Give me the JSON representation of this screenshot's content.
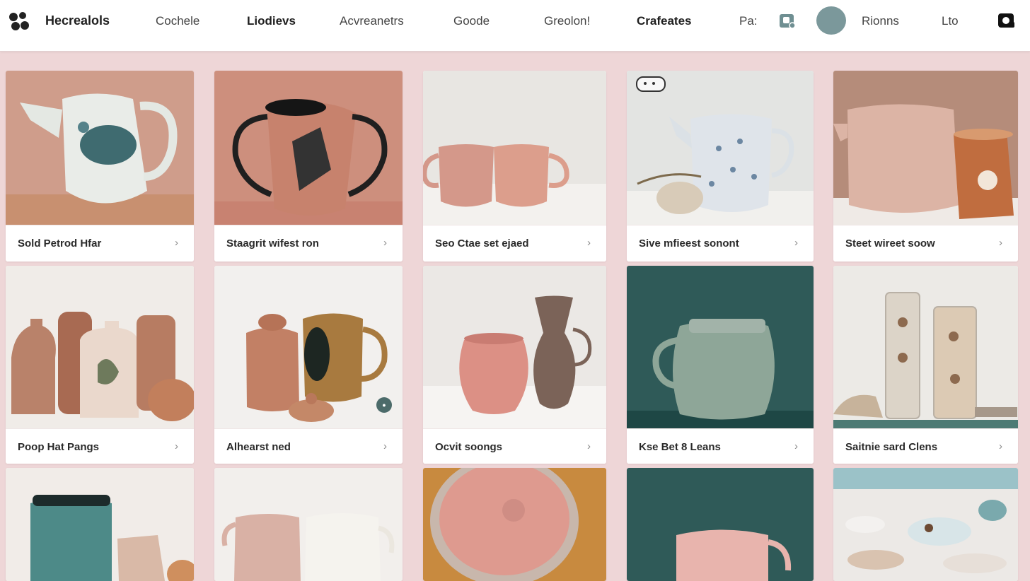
{
  "header": {
    "brand": "Hecrealols",
    "nav": [
      "Cochele",
      "Liodievs",
      "Acvreanetrs",
      "Goode",
      "Greolon!",
      "Crafeates",
      "Pa:"
    ],
    "avatar_text": "",
    "nav_right": [
      "Rionns",
      "Lto"
    ],
    "icons": [
      "logo-icon",
      "shopping-bag-icon",
      "message-icon"
    ]
  },
  "products": [
    {
      "label": "Sold Petrod Hfar"
    },
    {
      "label": "Staagrit wifest ron"
    },
    {
      "label": "Seo Ctae set ejaed"
    },
    {
      "label": "Sive mfieest sonont"
    },
    {
      "label": "Steet wireet soow"
    },
    {
      "label": "Poop Hat Pangs"
    },
    {
      "label": "Alhearst ned"
    },
    {
      "label": "Ocvit soongs"
    },
    {
      "label": "Kse Bet 8 Leans"
    },
    {
      "label": "Saitnie sard Clens"
    }
  ],
  "chevron": "›",
  "colors": {
    "background": "#eed6d7",
    "card": "#ffffff",
    "avatar": "#7b989b",
    "accent_teal": "#2f5a58"
  }
}
